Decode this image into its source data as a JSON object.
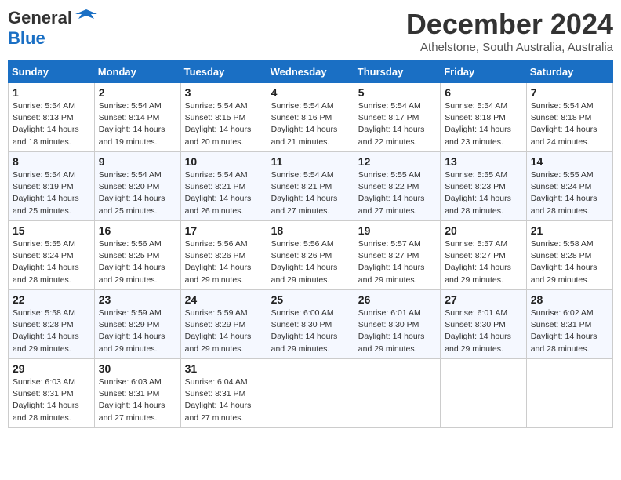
{
  "logo": {
    "line1": "General",
    "line2": "Blue"
  },
  "header": {
    "month": "December 2024",
    "location": "Athelstone, South Australia, Australia"
  },
  "weekdays": [
    "Sunday",
    "Monday",
    "Tuesday",
    "Wednesday",
    "Thursday",
    "Friday",
    "Saturday"
  ],
  "weeks": [
    [
      {
        "day": "1",
        "info": "Sunrise: 5:54 AM\nSunset: 8:13 PM\nDaylight: 14 hours\nand 18 minutes."
      },
      {
        "day": "2",
        "info": "Sunrise: 5:54 AM\nSunset: 8:14 PM\nDaylight: 14 hours\nand 19 minutes."
      },
      {
        "day": "3",
        "info": "Sunrise: 5:54 AM\nSunset: 8:15 PM\nDaylight: 14 hours\nand 20 minutes."
      },
      {
        "day": "4",
        "info": "Sunrise: 5:54 AM\nSunset: 8:16 PM\nDaylight: 14 hours\nand 21 minutes."
      },
      {
        "day": "5",
        "info": "Sunrise: 5:54 AM\nSunset: 8:17 PM\nDaylight: 14 hours\nand 22 minutes."
      },
      {
        "day": "6",
        "info": "Sunrise: 5:54 AM\nSunset: 8:18 PM\nDaylight: 14 hours\nand 23 minutes."
      },
      {
        "day": "7",
        "info": "Sunrise: 5:54 AM\nSunset: 8:18 PM\nDaylight: 14 hours\nand 24 minutes."
      }
    ],
    [
      {
        "day": "8",
        "info": "Sunrise: 5:54 AM\nSunset: 8:19 PM\nDaylight: 14 hours\nand 25 minutes."
      },
      {
        "day": "9",
        "info": "Sunrise: 5:54 AM\nSunset: 8:20 PM\nDaylight: 14 hours\nand 25 minutes."
      },
      {
        "day": "10",
        "info": "Sunrise: 5:54 AM\nSunset: 8:21 PM\nDaylight: 14 hours\nand 26 minutes."
      },
      {
        "day": "11",
        "info": "Sunrise: 5:54 AM\nSunset: 8:21 PM\nDaylight: 14 hours\nand 27 minutes."
      },
      {
        "day": "12",
        "info": "Sunrise: 5:55 AM\nSunset: 8:22 PM\nDaylight: 14 hours\nand 27 minutes."
      },
      {
        "day": "13",
        "info": "Sunrise: 5:55 AM\nSunset: 8:23 PM\nDaylight: 14 hours\nand 28 minutes."
      },
      {
        "day": "14",
        "info": "Sunrise: 5:55 AM\nSunset: 8:24 PM\nDaylight: 14 hours\nand 28 minutes."
      }
    ],
    [
      {
        "day": "15",
        "info": "Sunrise: 5:55 AM\nSunset: 8:24 PM\nDaylight: 14 hours\nand 28 minutes."
      },
      {
        "day": "16",
        "info": "Sunrise: 5:56 AM\nSunset: 8:25 PM\nDaylight: 14 hours\nand 29 minutes."
      },
      {
        "day": "17",
        "info": "Sunrise: 5:56 AM\nSunset: 8:26 PM\nDaylight: 14 hours\nand 29 minutes."
      },
      {
        "day": "18",
        "info": "Sunrise: 5:56 AM\nSunset: 8:26 PM\nDaylight: 14 hours\nand 29 minutes."
      },
      {
        "day": "19",
        "info": "Sunrise: 5:57 AM\nSunset: 8:27 PM\nDaylight: 14 hours\nand 29 minutes."
      },
      {
        "day": "20",
        "info": "Sunrise: 5:57 AM\nSunset: 8:27 PM\nDaylight: 14 hours\nand 29 minutes."
      },
      {
        "day": "21",
        "info": "Sunrise: 5:58 AM\nSunset: 8:28 PM\nDaylight: 14 hours\nand 29 minutes."
      }
    ],
    [
      {
        "day": "22",
        "info": "Sunrise: 5:58 AM\nSunset: 8:28 PM\nDaylight: 14 hours\nand 29 minutes."
      },
      {
        "day": "23",
        "info": "Sunrise: 5:59 AM\nSunset: 8:29 PM\nDaylight: 14 hours\nand 29 minutes."
      },
      {
        "day": "24",
        "info": "Sunrise: 5:59 AM\nSunset: 8:29 PM\nDaylight: 14 hours\nand 29 minutes."
      },
      {
        "day": "25",
        "info": "Sunrise: 6:00 AM\nSunset: 8:30 PM\nDaylight: 14 hours\nand 29 minutes."
      },
      {
        "day": "26",
        "info": "Sunrise: 6:01 AM\nSunset: 8:30 PM\nDaylight: 14 hours\nand 29 minutes."
      },
      {
        "day": "27",
        "info": "Sunrise: 6:01 AM\nSunset: 8:30 PM\nDaylight: 14 hours\nand 29 minutes."
      },
      {
        "day": "28",
        "info": "Sunrise: 6:02 AM\nSunset: 8:31 PM\nDaylight: 14 hours\nand 28 minutes."
      }
    ],
    [
      {
        "day": "29",
        "info": "Sunrise: 6:03 AM\nSunset: 8:31 PM\nDaylight: 14 hours\nand 28 minutes."
      },
      {
        "day": "30",
        "info": "Sunrise: 6:03 AM\nSunset: 8:31 PM\nDaylight: 14 hours\nand 27 minutes."
      },
      {
        "day": "31",
        "info": "Sunrise: 6:04 AM\nSunset: 8:31 PM\nDaylight: 14 hours\nand 27 minutes."
      },
      null,
      null,
      null,
      null
    ]
  ]
}
